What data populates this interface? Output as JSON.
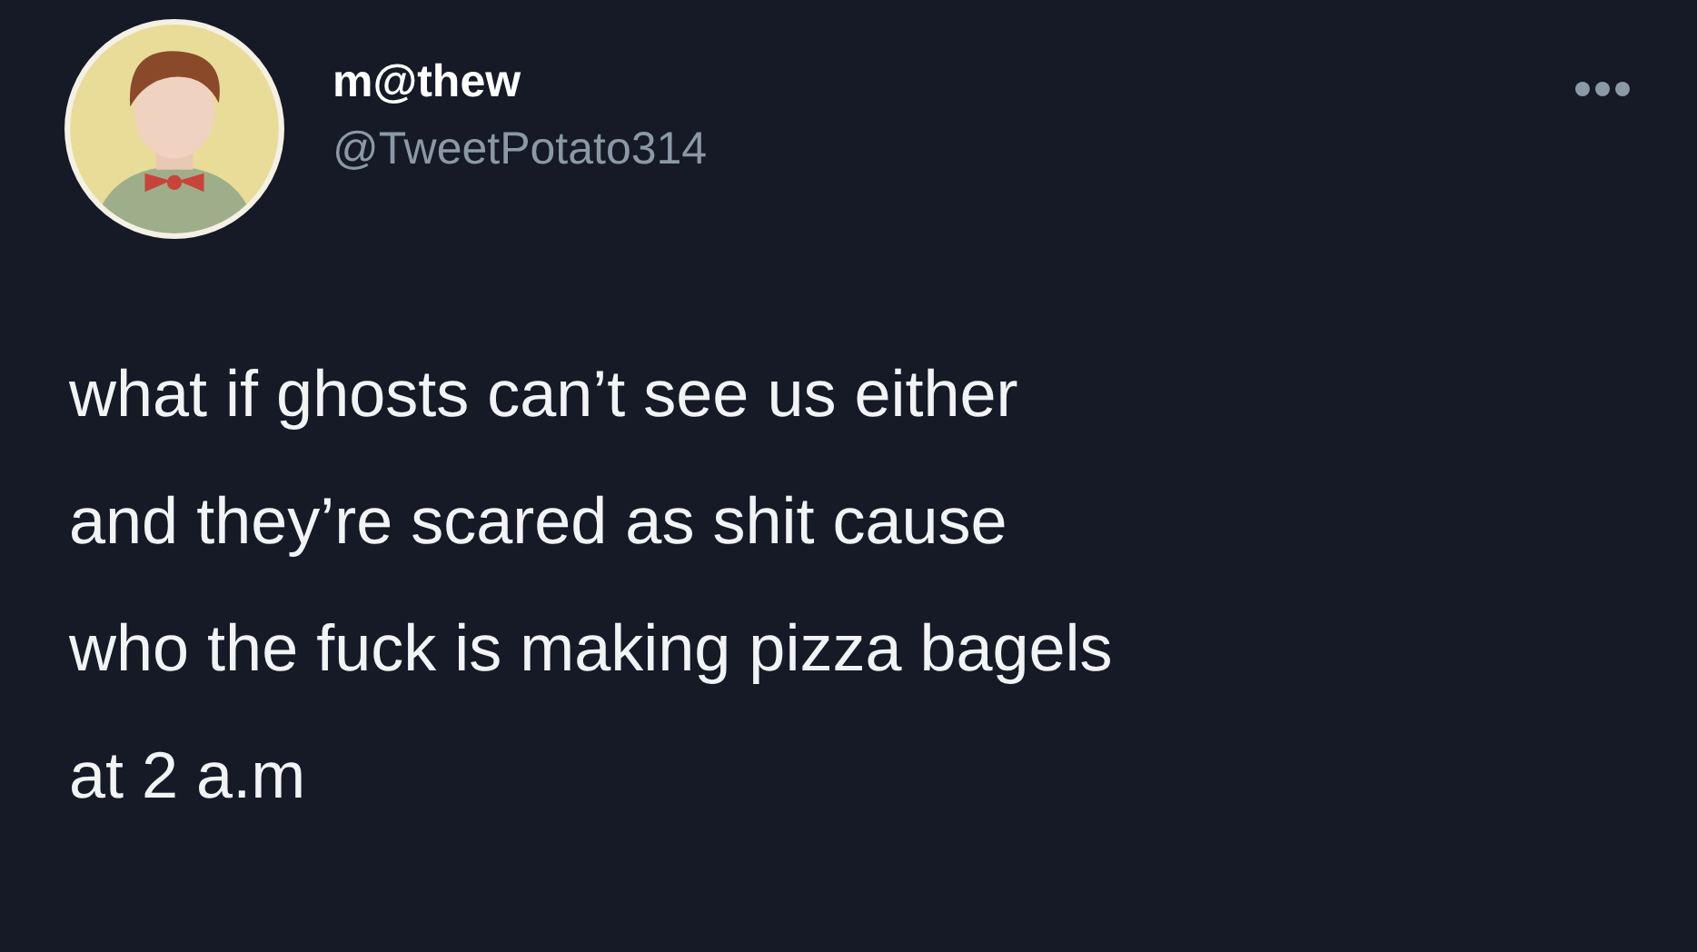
{
  "author": {
    "name": "m@thew",
    "handle": "@TweetPotato314"
  },
  "tweet": {
    "lines": [
      "what if ghosts can’t see us either",
      "and they’re scared as shit cause",
      "who the fuck is making pizza bagels",
      "at 2 a.m"
    ]
  }
}
